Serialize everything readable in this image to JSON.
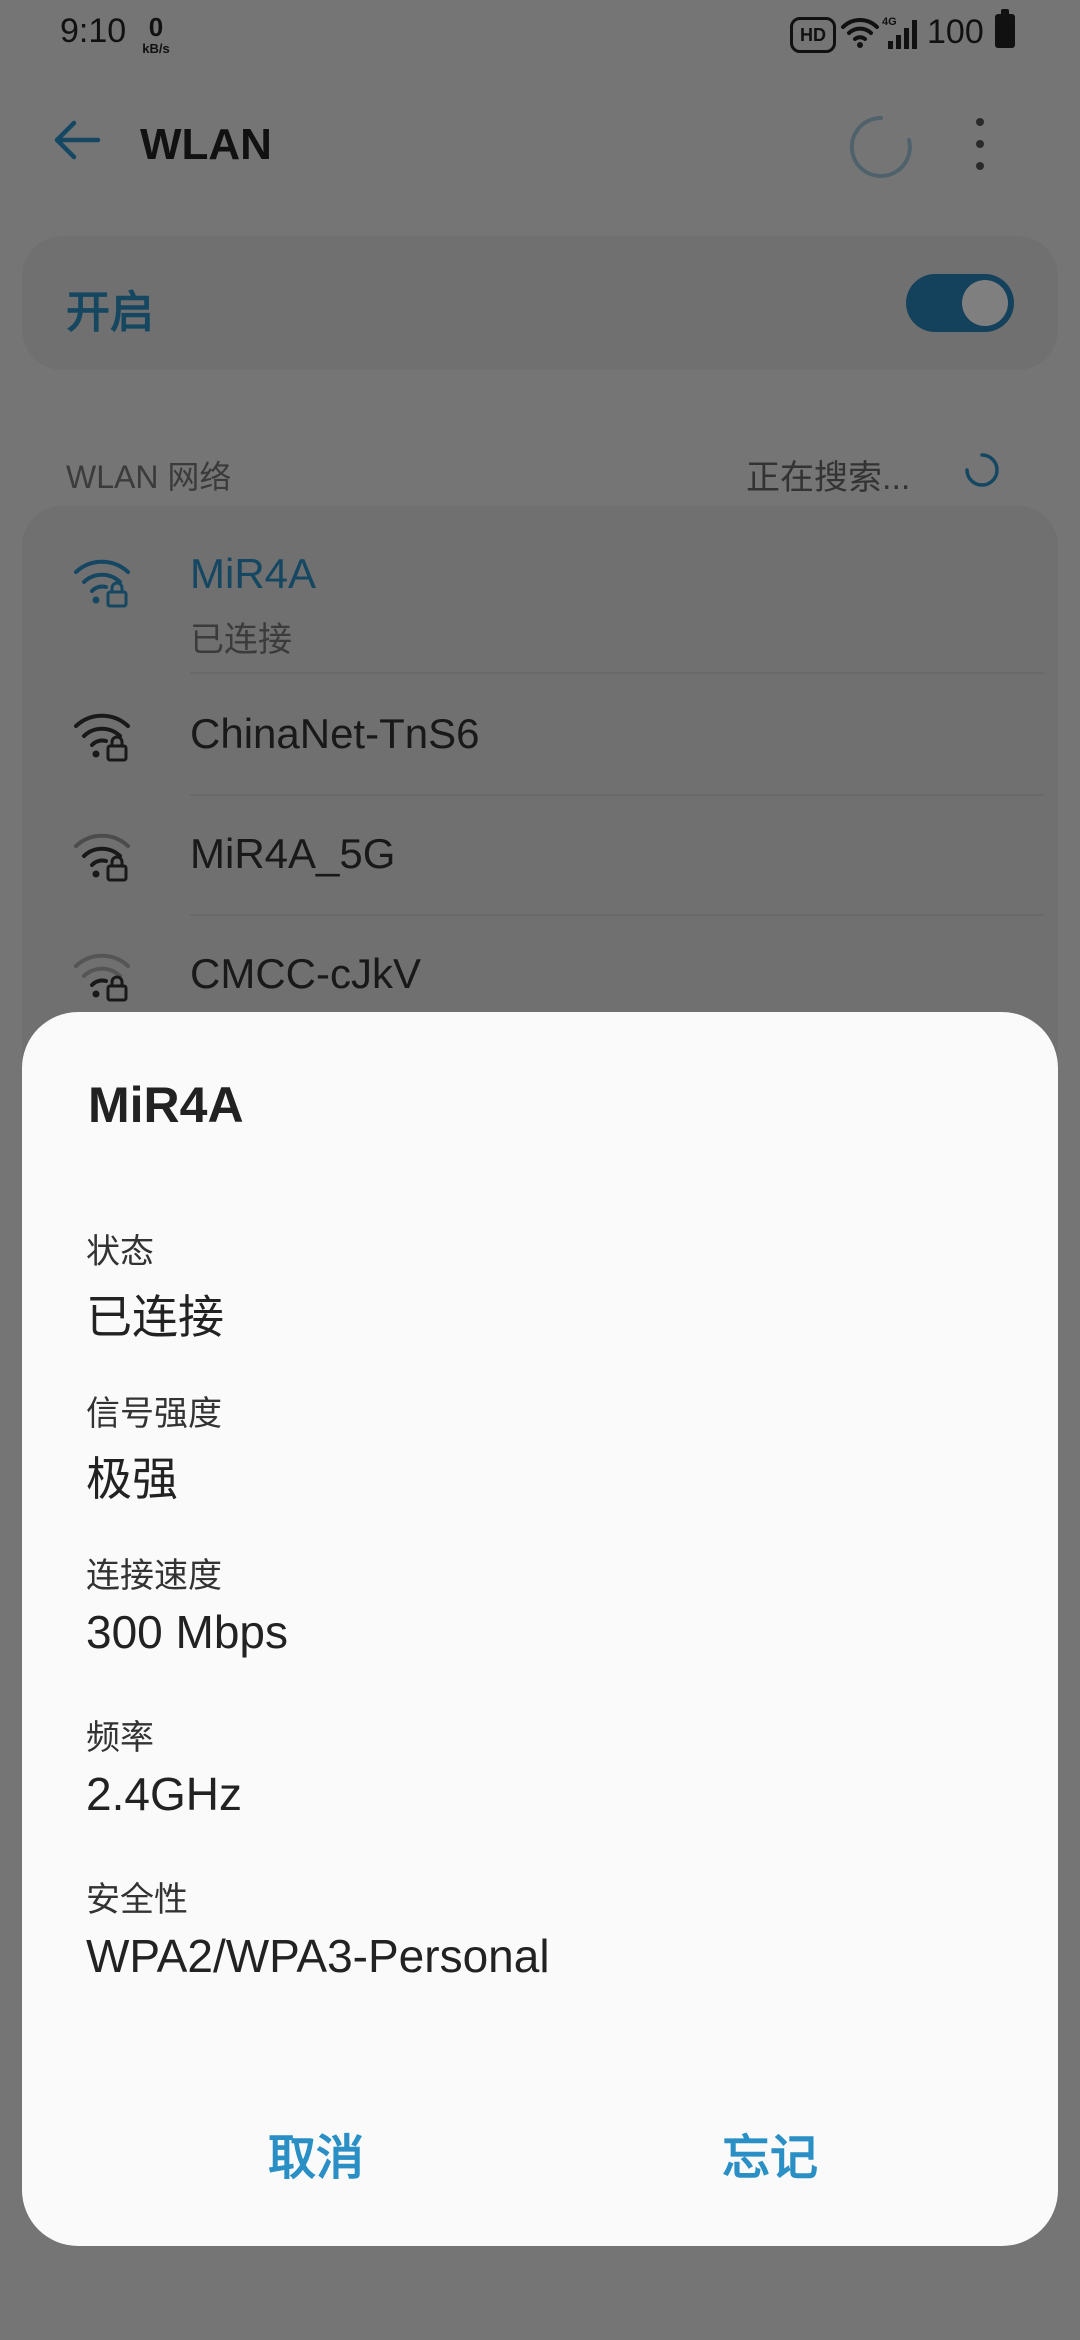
{
  "status_bar": {
    "time": "9:10",
    "net_speed_value": "0",
    "net_speed_unit": "kB/s",
    "hd_badge": "HD",
    "network_type": "4G",
    "battery": "100"
  },
  "app_bar": {
    "title": "WLAN",
    "icons": [
      "back-arrow-icon",
      "refresh-icon",
      "more-vert-icon"
    ]
  },
  "wlan_toggle": {
    "label": "开启",
    "on": true
  },
  "network_section": {
    "label": "WLAN 网络",
    "status": "正在搜索..."
  },
  "networks": [
    {
      "name": "MiR4A",
      "status": "已连接",
      "connected": true
    },
    {
      "name": "ChinaNet-TnS6"
    },
    {
      "name": "MiR4A_5G"
    },
    {
      "name": "CMCC-cJkV"
    }
  ],
  "dialog": {
    "title": "MiR4A",
    "fields": [
      {
        "label": "状态",
        "value": "已连接"
      },
      {
        "label": "信号强度",
        "value": "极强"
      },
      {
        "label": "连接速度",
        "value": "300 Mbps"
      },
      {
        "label": "频率",
        "value": "2.4GHz"
      },
      {
        "label": "安全性",
        "value": "WPA2/WPA3-Personal"
      }
    ],
    "cancel_label": "取消",
    "forget_label": "忘记"
  },
  "colors": {
    "accent": "#2a8fc4",
    "switch_track": "#2882b8",
    "dialog_background": "#fafafa",
    "scrim": "rgba(0,0,0,0.5)"
  }
}
